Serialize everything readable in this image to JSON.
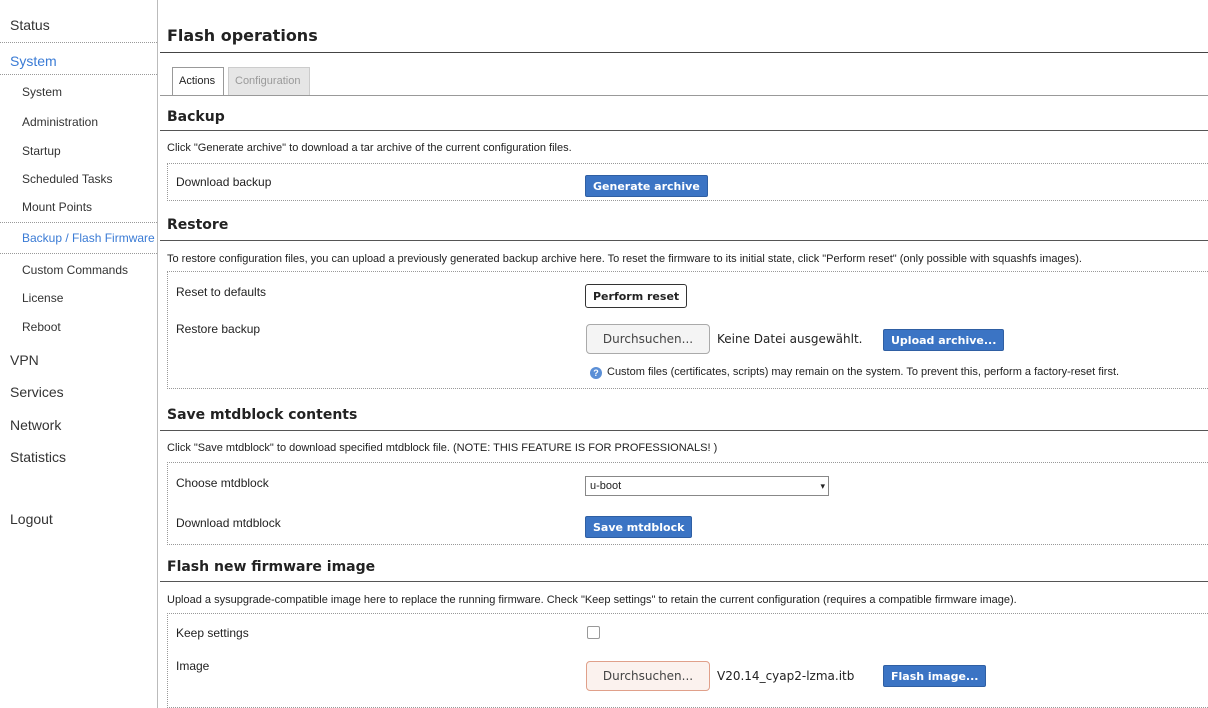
{
  "sidebar": {
    "top": [
      "Status",
      "System",
      "VPN",
      "Services",
      "Network",
      "Statistics",
      "Logout"
    ],
    "sub": [
      "System",
      "Administration",
      "Startup",
      "Scheduled Tasks",
      "Mount Points",
      "Backup / Flash Firmware",
      "Custom Commands",
      "License",
      "Reboot"
    ]
  },
  "page": {
    "title": "Flash operations",
    "tabs": [
      "Actions",
      "Configuration"
    ]
  },
  "backup": {
    "title": "Backup",
    "desc": "Click \"Generate archive\" to download a tar archive of the current configuration files.",
    "download_label": "Download backup",
    "generate_button": "Generate archive"
  },
  "restore": {
    "title": "Restore",
    "desc": "To restore configuration files, you can upload a previously generated backup archive here. To reset the firmware to its initial state, click \"Perform reset\" (only possible with squashfs images).",
    "reset_label": "Reset to defaults",
    "reset_button": "Perform reset",
    "restore_label": "Restore backup",
    "browse_button": "Durchsuchen...",
    "file_status": "Keine Datei ausgewählt.",
    "upload_button": "Upload archive...",
    "hint": "Custom files (certificates, scripts) may remain on the system. To prevent this, perform a factory-reset first."
  },
  "mtd": {
    "title": "Save mtdblock contents",
    "desc": "Click \"Save mtdblock\" to download specified mtdblock file. (NOTE: THIS FEATURE IS FOR PROFESSIONALS! )",
    "choose_label": "Choose mtdblock",
    "selected": "u-boot",
    "download_label": "Download mtdblock",
    "save_button": "Save mtdblock"
  },
  "flash": {
    "title": "Flash new firmware image",
    "desc": "Upload a sysupgrade-compatible image here to replace the running firmware. Check \"Keep settings\" to retain the current configuration (requires a compatible firmware image).",
    "keep_label": "Keep settings",
    "image_label": "Image",
    "browse_button": "Durchsuchen...",
    "file_name": "V20.14_cyap2-lzma.itb",
    "flash_button": "Flash image..."
  }
}
